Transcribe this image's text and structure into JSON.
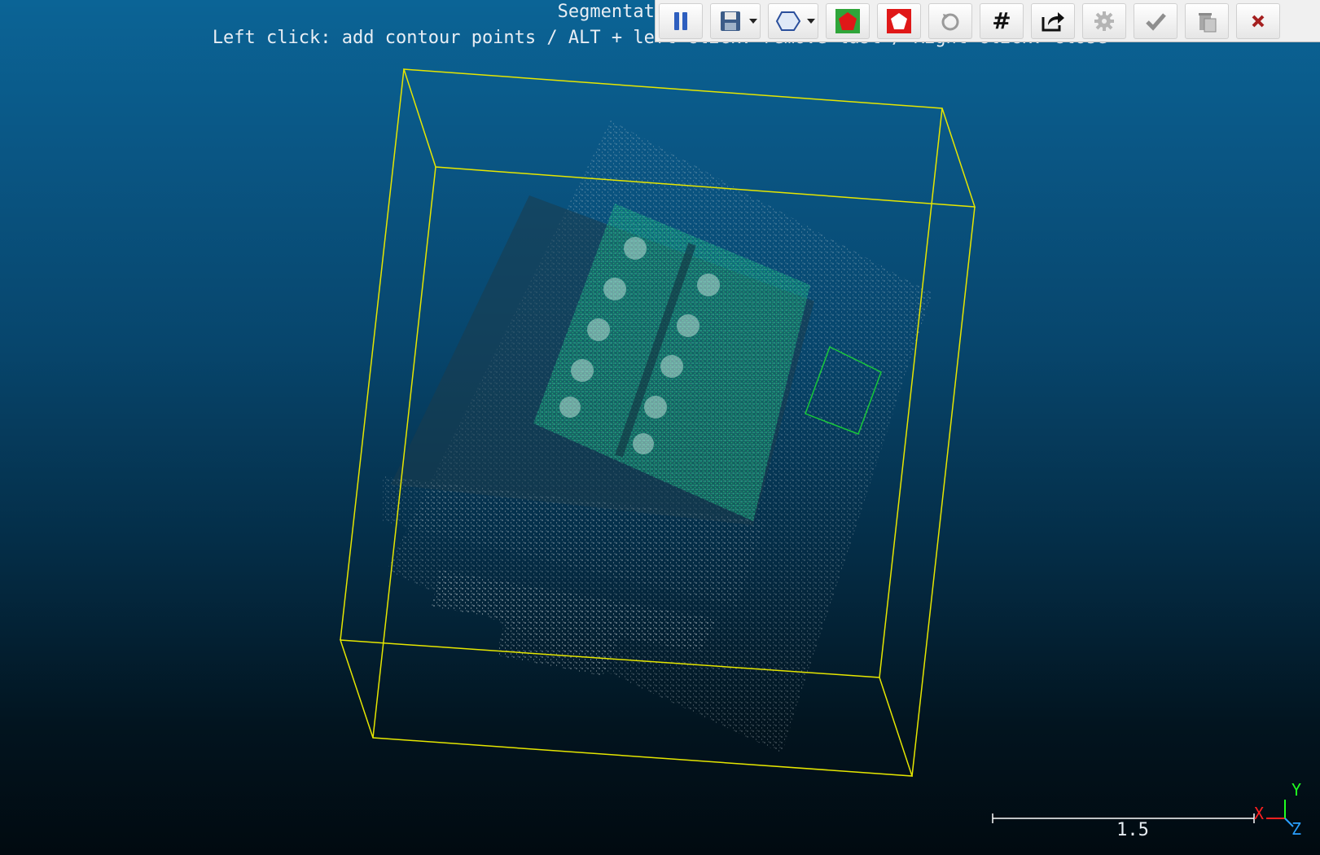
{
  "overlay": {
    "line1": "Segmentation [ON] (",
    "line2": "Left click: add contour points / ALT + left click: remove last / Right click: close"
  },
  "toolbar": {
    "buttons": [
      {
        "name": "pause-button",
        "icon": "pause-icon"
      },
      {
        "name": "save-button",
        "icon": "save-icon",
        "dropdown": true
      },
      {
        "name": "polygon-mode-button",
        "icon": "polygon-icon",
        "dropdown": true
      },
      {
        "name": "segment-in-button",
        "icon": "pentagon-filled-red-icon"
      },
      {
        "name": "segment-out-button",
        "icon": "pentagon-outline-red-icon"
      },
      {
        "name": "reset-button",
        "icon": "reset-icon"
      },
      {
        "name": "grid-button",
        "icon": "hash-icon",
        "glyph": "#"
      },
      {
        "name": "export-button",
        "icon": "export-icon"
      },
      {
        "name": "settings-button",
        "icon": "gear-icon"
      },
      {
        "name": "confirm-button",
        "icon": "check-icon"
      },
      {
        "name": "delete-button",
        "icon": "trash-icon"
      },
      {
        "name": "cancel-button",
        "icon": "close-icon"
      }
    ]
  },
  "scale_bar": {
    "label": "1.5"
  },
  "axes": {
    "x": "X",
    "y": "Y",
    "z": "Z"
  },
  "colors": {
    "bbox": "#e6e600",
    "contour": "#19c83a",
    "cloud_green": "#2fd9a0",
    "cloud_white": "#dcdcdc",
    "axis_x": "#ff2020",
    "axis_y": "#20ff20",
    "axis_z": "#2aa0ff"
  }
}
